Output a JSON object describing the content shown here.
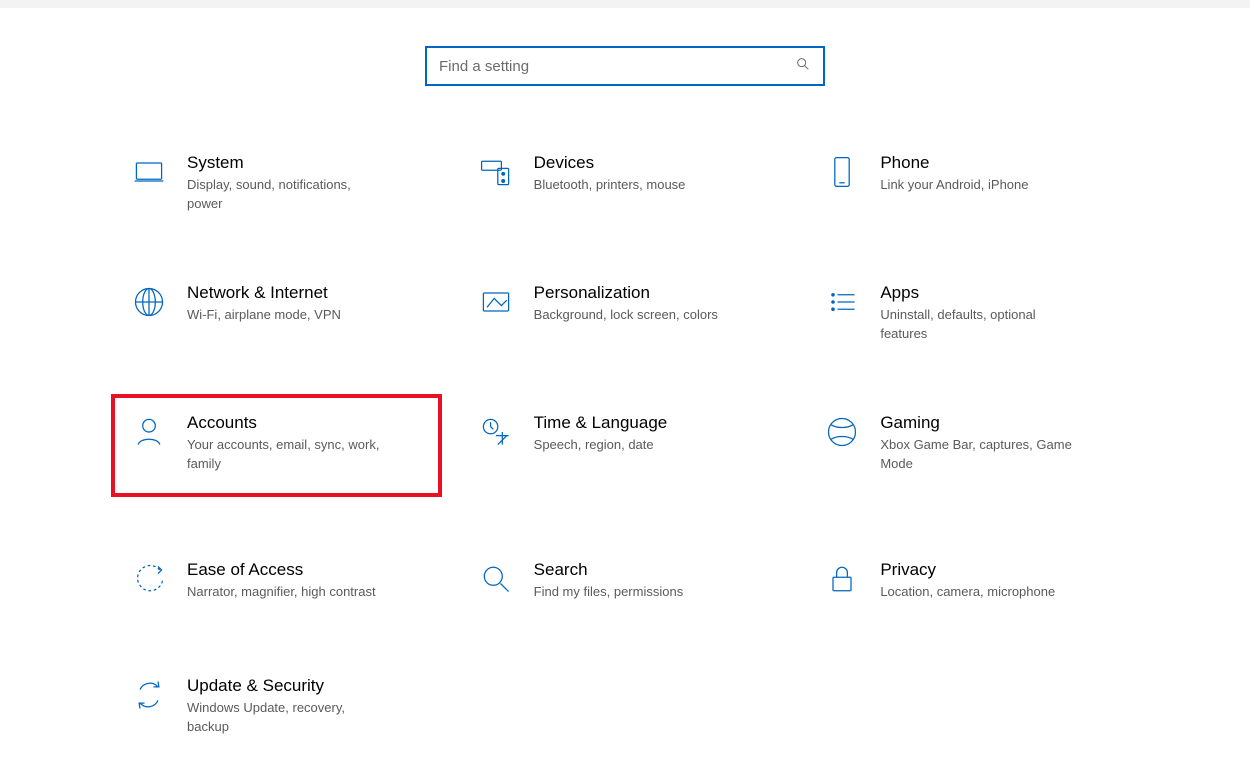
{
  "search": {
    "placeholder": "Find a setting"
  },
  "tiles": {
    "system": {
      "title": "System",
      "desc": "Display, sound, notifications, power"
    },
    "devices": {
      "title": "Devices",
      "desc": "Bluetooth, printers, mouse"
    },
    "phone": {
      "title": "Phone",
      "desc": "Link your Android, iPhone"
    },
    "network": {
      "title": "Network & Internet",
      "desc": "Wi-Fi, airplane mode, VPN"
    },
    "personalize": {
      "title": "Personalization",
      "desc": "Background, lock screen, colors"
    },
    "apps": {
      "title": "Apps",
      "desc": "Uninstall, defaults, optional features"
    },
    "accounts": {
      "title": "Accounts",
      "desc": "Your accounts, email, sync, work, family"
    },
    "time": {
      "title": "Time & Language",
      "desc": "Speech, region, date"
    },
    "gaming": {
      "title": "Gaming",
      "desc": "Xbox Game Bar, captures, Game Mode"
    },
    "ease": {
      "title": "Ease of Access",
      "desc": "Narrator, magnifier, high contrast"
    },
    "searchcat": {
      "title": "Search",
      "desc": "Find my files, permissions"
    },
    "privacy": {
      "title": "Privacy",
      "desc": "Location, camera, microphone"
    },
    "update": {
      "title": "Update & Security",
      "desc": "Windows Update, recovery, backup"
    }
  }
}
